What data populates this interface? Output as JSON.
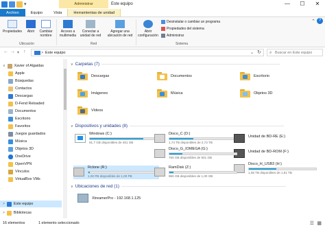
{
  "title_bar": {
    "context_label": "Administrar",
    "title": "Este equipo",
    "minimize": "—",
    "maximize": "☐",
    "close": "✕"
  },
  "tabs": [
    "Archivo",
    "Equipo",
    "Vista",
    "Herramientas de unidad"
  ],
  "ribbon": {
    "ubicacion": {
      "group": "Ubicación",
      "props": "Propiedades",
      "abrir": "Abrir",
      "cambiar": "Cambiar nombre"
    },
    "red": {
      "group": "Red",
      "acceso": "Acceso a multimedia",
      "conectar": "Conectar a unidad de red",
      "agregar": "Agregar una ubicación de red"
    },
    "sistema": {
      "group": "Sistema",
      "abrir_config": "Abrir configuración",
      "desinstalar": "Desinstalar o cambiar un programa",
      "propiedades_sistema": "Propiedades del sistema",
      "administrar": "Administrar"
    }
  },
  "address": {
    "path": "Este equipo",
    "separator": ">",
    "search_placeholder": "Buscar en Este equipo"
  },
  "nav": {
    "items": [
      "Xavier of Algaidas",
      "Apple",
      "Búsquedas",
      "Contactos",
      "Descargas",
      "D-Fend Reloaded",
      "Documentos",
      "Escritorio",
      "Favoritos",
      "Juegos guardados",
      "Música",
      "Objetos 3D",
      "OneDrive",
      "OpenVPN",
      "Vínculos",
      "VirtualBox VMs",
      "Este equipo",
      "Bibliotecas"
    ]
  },
  "sections": {
    "carpetas": "Carpetas (7)",
    "dispositivos": "Dispositivos y unidades (8)",
    "red": "Ubicaciones de red (1)"
  },
  "folders": [
    "Descargas",
    "Documentos",
    "Escritorio",
    "Imágenes",
    "Música",
    "Objetos 3D",
    "Vídeos"
  ],
  "drives": [
    {
      "name": "Windows (C:)",
      "free": "91,7 GB disponibles de 451 GB",
      "used": 0.8
    },
    {
      "name": "Disco_C (D:)",
      "free": "1,74 TB disponibles de 2,72 TB",
      "used": 0.36
    },
    {
      "name": "Unidad de BD-RE (E:)",
      "free": "",
      "used": null
    },
    {
      "name": "Unidad de BD-ROM (F:)",
      "free": "",
      "used": null
    },
    {
      "name": "Disco_G_IOMEGA (G:)",
      "free": "750 GB disponibles de 931 GB",
      "used": 0.19
    },
    {
      "name": "Disco_H_USB3 (H:)",
      "free": "1,06 TB disponibles de 1,81 TB",
      "used": 0.41
    },
    {
      "name": "Rclone (R:)",
      "free": "1,00 PB disponibles de 1,00 PB",
      "used": 0.02
    },
    {
      "name": "RamDisk (Z:)",
      "free": "960 GB disponibles de 1,00 GB",
      "used": 0.06
    }
  ],
  "network": [
    {
      "name": "XtreamerPro - 192.168.1.125"
    }
  ],
  "status": {
    "count": "16 elementos",
    "selected": "1 elemento seleccionado"
  },
  "colors": {
    "accent": "#1979ca",
    "bar": "#26a0da",
    "folder": "#f3c14a",
    "selected": "#cce8ff"
  }
}
